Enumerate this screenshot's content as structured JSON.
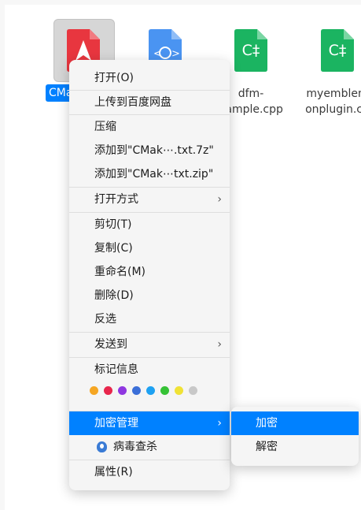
{
  "desktop": {
    "files": [
      {
        "name": "CMak",
        "icon": "pdf-file-icon",
        "selected": true
      },
      {
        "name": "",
        "icon": "web-file-icon"
      },
      {
        "name_line1": "dfm-",
        "name_line2": "xample.cpp",
        "icon": "cpp-file-icon",
        "glyph": "C‡"
      },
      {
        "name_line1": "myemblem",
        "name_line2": "onplugin.cp",
        "icon": "cpp-file-icon",
        "glyph": "C‡"
      }
    ]
  },
  "menu": {
    "open": "打开(O)",
    "upload_baidu": "上传到百度网盘",
    "compress": "压缩",
    "add_to_7z": "添加到\"CMak⋯.txt.7z\"",
    "add_to_zip": "添加到\"CMak⋯txt.zip\"",
    "open_with": "打开方式",
    "cut": "剪切(T)",
    "copy": "复制(C)",
    "rename": "重命名(M)",
    "delete": "删除(D)",
    "invert_selection": "反选",
    "send_to": "发送到",
    "tag_info": "标记信息",
    "encryption": "加密管理",
    "virus_scan": "病毒查杀",
    "properties": "属性(R)",
    "submenu_arrow": "›"
  },
  "tag_colors": [
    "#f5a623",
    "#e8264c",
    "#8f37e0",
    "#3b6fd8",
    "#1ea1f2",
    "#35c235",
    "#f0e236",
    "#c8c8c8"
  ],
  "submenu": {
    "encrypt": "加密",
    "decrypt": "解密"
  },
  "colors": {
    "accent": "#0081ff"
  }
}
